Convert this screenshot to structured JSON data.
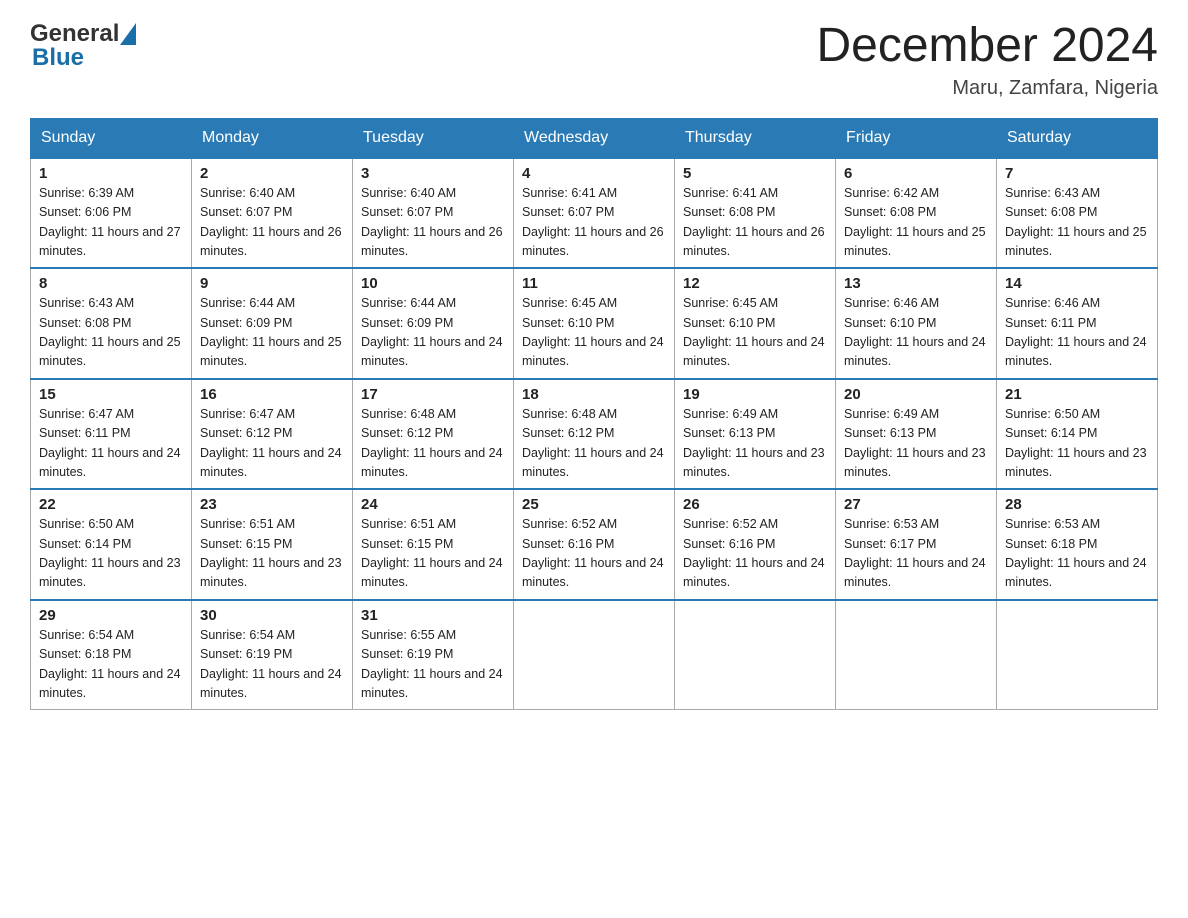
{
  "header": {
    "logo_general": "General",
    "logo_blue": "Blue",
    "month_title": "December 2024",
    "location": "Maru, Zamfara, Nigeria"
  },
  "days_of_week": [
    "Sunday",
    "Monday",
    "Tuesday",
    "Wednesday",
    "Thursday",
    "Friday",
    "Saturday"
  ],
  "weeks": [
    [
      {
        "day": "1",
        "sunrise": "6:39 AM",
        "sunset": "6:06 PM",
        "daylight": "11 hours and 27 minutes."
      },
      {
        "day": "2",
        "sunrise": "6:40 AM",
        "sunset": "6:07 PM",
        "daylight": "11 hours and 26 minutes."
      },
      {
        "day": "3",
        "sunrise": "6:40 AM",
        "sunset": "6:07 PM",
        "daylight": "11 hours and 26 minutes."
      },
      {
        "day": "4",
        "sunrise": "6:41 AM",
        "sunset": "6:07 PM",
        "daylight": "11 hours and 26 minutes."
      },
      {
        "day": "5",
        "sunrise": "6:41 AM",
        "sunset": "6:08 PM",
        "daylight": "11 hours and 26 minutes."
      },
      {
        "day": "6",
        "sunrise": "6:42 AM",
        "sunset": "6:08 PM",
        "daylight": "11 hours and 25 minutes."
      },
      {
        "day": "7",
        "sunrise": "6:43 AM",
        "sunset": "6:08 PM",
        "daylight": "11 hours and 25 minutes."
      }
    ],
    [
      {
        "day": "8",
        "sunrise": "6:43 AM",
        "sunset": "6:08 PM",
        "daylight": "11 hours and 25 minutes."
      },
      {
        "day": "9",
        "sunrise": "6:44 AM",
        "sunset": "6:09 PM",
        "daylight": "11 hours and 25 minutes."
      },
      {
        "day": "10",
        "sunrise": "6:44 AM",
        "sunset": "6:09 PM",
        "daylight": "11 hours and 24 minutes."
      },
      {
        "day": "11",
        "sunrise": "6:45 AM",
        "sunset": "6:10 PM",
        "daylight": "11 hours and 24 minutes."
      },
      {
        "day": "12",
        "sunrise": "6:45 AM",
        "sunset": "6:10 PM",
        "daylight": "11 hours and 24 minutes."
      },
      {
        "day": "13",
        "sunrise": "6:46 AM",
        "sunset": "6:10 PM",
        "daylight": "11 hours and 24 minutes."
      },
      {
        "day": "14",
        "sunrise": "6:46 AM",
        "sunset": "6:11 PM",
        "daylight": "11 hours and 24 minutes."
      }
    ],
    [
      {
        "day": "15",
        "sunrise": "6:47 AM",
        "sunset": "6:11 PM",
        "daylight": "11 hours and 24 minutes."
      },
      {
        "day": "16",
        "sunrise": "6:47 AM",
        "sunset": "6:12 PM",
        "daylight": "11 hours and 24 minutes."
      },
      {
        "day": "17",
        "sunrise": "6:48 AM",
        "sunset": "6:12 PM",
        "daylight": "11 hours and 24 minutes."
      },
      {
        "day": "18",
        "sunrise": "6:48 AM",
        "sunset": "6:12 PM",
        "daylight": "11 hours and 24 minutes."
      },
      {
        "day": "19",
        "sunrise": "6:49 AM",
        "sunset": "6:13 PM",
        "daylight": "11 hours and 23 minutes."
      },
      {
        "day": "20",
        "sunrise": "6:49 AM",
        "sunset": "6:13 PM",
        "daylight": "11 hours and 23 minutes."
      },
      {
        "day": "21",
        "sunrise": "6:50 AM",
        "sunset": "6:14 PM",
        "daylight": "11 hours and 23 minutes."
      }
    ],
    [
      {
        "day": "22",
        "sunrise": "6:50 AM",
        "sunset": "6:14 PM",
        "daylight": "11 hours and 23 minutes."
      },
      {
        "day": "23",
        "sunrise": "6:51 AM",
        "sunset": "6:15 PM",
        "daylight": "11 hours and 23 minutes."
      },
      {
        "day": "24",
        "sunrise": "6:51 AM",
        "sunset": "6:15 PM",
        "daylight": "11 hours and 24 minutes."
      },
      {
        "day": "25",
        "sunrise": "6:52 AM",
        "sunset": "6:16 PM",
        "daylight": "11 hours and 24 minutes."
      },
      {
        "day": "26",
        "sunrise": "6:52 AM",
        "sunset": "6:16 PM",
        "daylight": "11 hours and 24 minutes."
      },
      {
        "day": "27",
        "sunrise": "6:53 AM",
        "sunset": "6:17 PM",
        "daylight": "11 hours and 24 minutes."
      },
      {
        "day": "28",
        "sunrise": "6:53 AM",
        "sunset": "6:18 PM",
        "daylight": "11 hours and 24 minutes."
      }
    ],
    [
      {
        "day": "29",
        "sunrise": "6:54 AM",
        "sunset": "6:18 PM",
        "daylight": "11 hours and 24 minutes."
      },
      {
        "day": "30",
        "sunrise": "6:54 AM",
        "sunset": "6:19 PM",
        "daylight": "11 hours and 24 minutes."
      },
      {
        "day": "31",
        "sunrise": "6:55 AM",
        "sunset": "6:19 PM",
        "daylight": "11 hours and 24 minutes."
      },
      null,
      null,
      null,
      null
    ]
  ],
  "labels": {
    "sunrise": "Sunrise:",
    "sunset": "Sunset:",
    "daylight": "Daylight:"
  }
}
